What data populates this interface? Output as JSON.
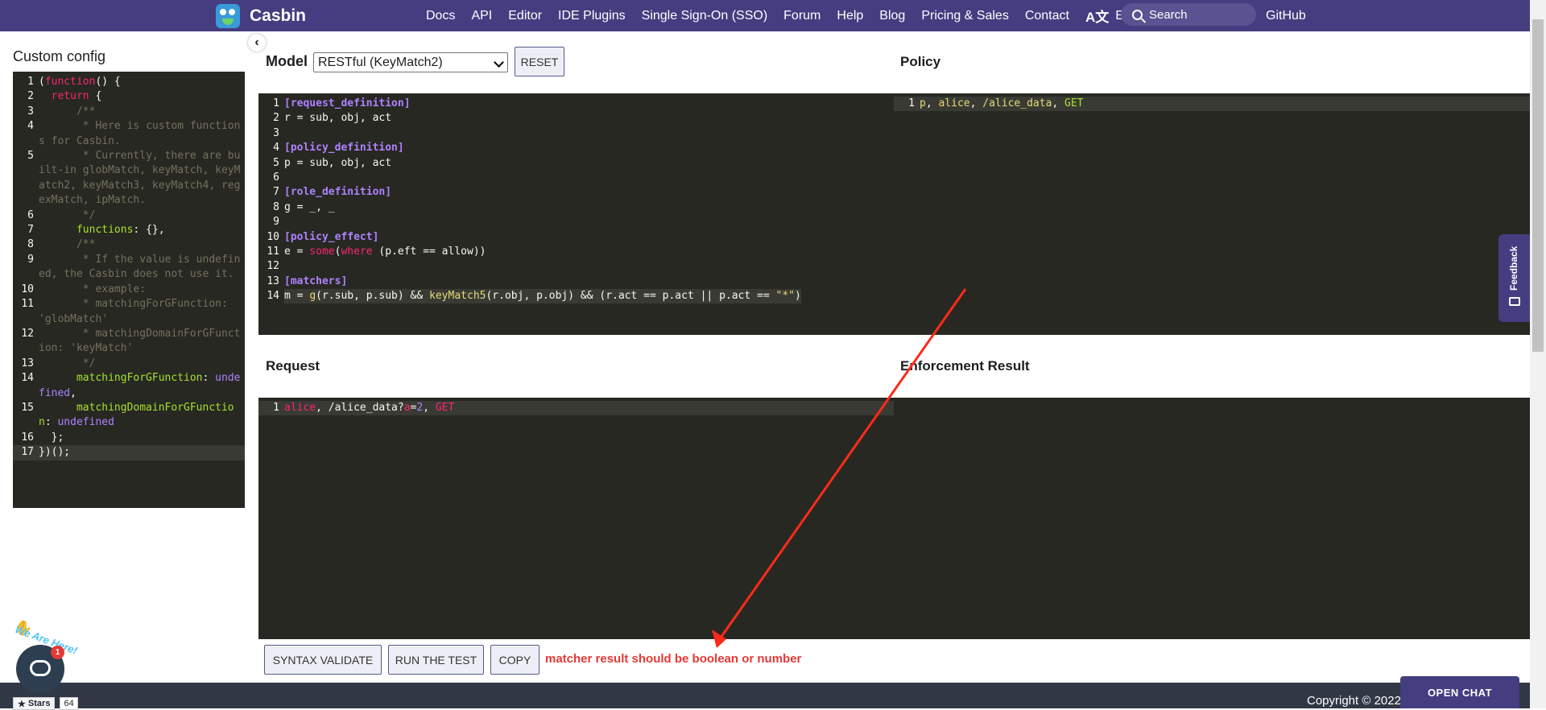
{
  "nav": {
    "brand": "Casbin",
    "links": [
      "Docs",
      "API",
      "Editor",
      "IDE Plugins",
      "Single Sign-On (SSO)",
      "Forum",
      "Help",
      "Blog",
      "Pricing & Sales",
      "Contact"
    ],
    "language": "English",
    "search_placeholder": "Search",
    "github": "GitHub"
  },
  "custom_config": {
    "title": "Custom config",
    "collapse_icon": "chevron-left-icon",
    "lines": [
      {
        "n": "1",
        "html": "(<span class=\"kw\">function</span>() {"
      },
      {
        "n": "2",
        "html": "  <span class=\"kw\">return</span> {"
      },
      {
        "n": "3",
        "html": "      <span class=\"cm\">/**</span>"
      },
      {
        "n": "4",
        "html": "<span class=\"cm\">       * Here is custom functions for Casbin.</span>"
      },
      {
        "n": "5",
        "html": "<span class=\"cm\">       * Currently, there are built-in globMatch, keyMatch, keyMatch2, keyMatch3, keyMatch4, regexMatch, ipMatch.</span>"
      },
      {
        "n": "6",
        "html": "<span class=\"cm\">       */</span>"
      },
      {
        "n": "7",
        "html": "      <span class=\"pr\">functions</span>: {},"
      },
      {
        "n": "8",
        "html": "      <span class=\"cm\">/**</span>"
      },
      {
        "n": "9",
        "html": "<span class=\"cm\">       * If the value is undefined, the Casbin does not use it.</span>"
      },
      {
        "n": "10",
        "html": "<span class=\"cm\">       * example:</span>"
      },
      {
        "n": "11",
        "html": "<span class=\"cm\">       * matchingForGFunction: 'globMatch'</span>"
      },
      {
        "n": "12",
        "html": "<span class=\"cm\">       * matchingDomainForGFunction: 'keyMatch'</span>"
      },
      {
        "n": "13",
        "html": "<span class=\"cm\">       */</span>"
      },
      {
        "n": "14",
        "html": "      <span class=\"pr\">matchingForGFunction</span>: <span class=\"bl\">undefined</span>,"
      },
      {
        "n": "15",
        "html": "      <span class=\"pr\">matchingDomainForGFunction</span>: <span class=\"bl\">undefined</span>"
      },
      {
        "n": "16",
        "html": "  };"
      },
      {
        "n": "17",
        "html": "})();"
      }
    ]
  },
  "model": {
    "label": "Model",
    "selected": "RESTful (KeyMatch2)",
    "reset_label": "RESET",
    "lines": [
      {
        "n": "1",
        "html": "<span class=\"hd\">[request_definition]</span>"
      },
      {
        "n": "2",
        "html": "r = sub, obj, act"
      },
      {
        "n": "3",
        "html": ""
      },
      {
        "n": "4",
        "html": "<span class=\"hd\">[policy_definition]</span>"
      },
      {
        "n": "5",
        "html": "p = sub, obj, act"
      },
      {
        "n": "6",
        "html": ""
      },
      {
        "n": "7",
        "html": "<span class=\"hd\">[role_definition]</span>"
      },
      {
        "n": "8",
        "html": "g = _, _"
      },
      {
        "n": "9",
        "html": ""
      },
      {
        "n": "10",
        "html": "<span class=\"hd\">[policy_effect]</span>"
      },
      {
        "n": "11",
        "html": "e = <span class=\"kw\">some</span>(<span class=\"kw\">where</span> (p.eft == allow))"
      },
      {
        "n": "12",
        "html": ""
      },
      {
        "n": "13",
        "html": "<span class=\"hd\">[matchers]</span>"
      },
      {
        "n": "14",
        "html": "m = <span class=\"fn\">g</span>(r.sub, p.sub) &amp;&amp; <span class=\"fn\">keyMatch5</span>(r.obj, p.obj) &amp;&amp; (r.act == p.act || p.act == <span class=\"str\">\"*\"</span>)"
      }
    ]
  },
  "policy": {
    "label": "Policy",
    "lines": [
      {
        "n": "1",
        "html": "<span class=\"fn\">p</span>, <span class=\"str\">alice</span>, <span class=\"str\">/alice_data</span>, <span class=\"pr\">GET</span>"
      }
    ]
  },
  "request": {
    "label": "Request",
    "lines": [
      {
        "n": "1",
        "html": "<span class=\"kw\">alice</span>, /alice_data?<span class=\"kw\">a</span>=<span class=\"bl\">2</span>, <span class=\"kw\">GET</span>"
      }
    ]
  },
  "result": {
    "label": "Enforcement Result"
  },
  "actions": {
    "syntax_validate": "SYNTAX VALIDATE",
    "run_test": "RUN THE TEST",
    "copy": "COPY",
    "error": "matcher result should be boolean or number"
  },
  "widgets": {
    "feedback": "Feedback",
    "open_chat": "OPEN CHAT",
    "chat_badge": "1",
    "we_are_here": "We Are Here!",
    "github_stars_label": "Stars",
    "github_stars_count": "64",
    "copyright": "Copyright © 2022"
  },
  "colors": {
    "navbar": "#443d80",
    "editor_bg": "#272822",
    "error_text": "#e53935",
    "annotation_arrow": "#ff2a1a"
  }
}
